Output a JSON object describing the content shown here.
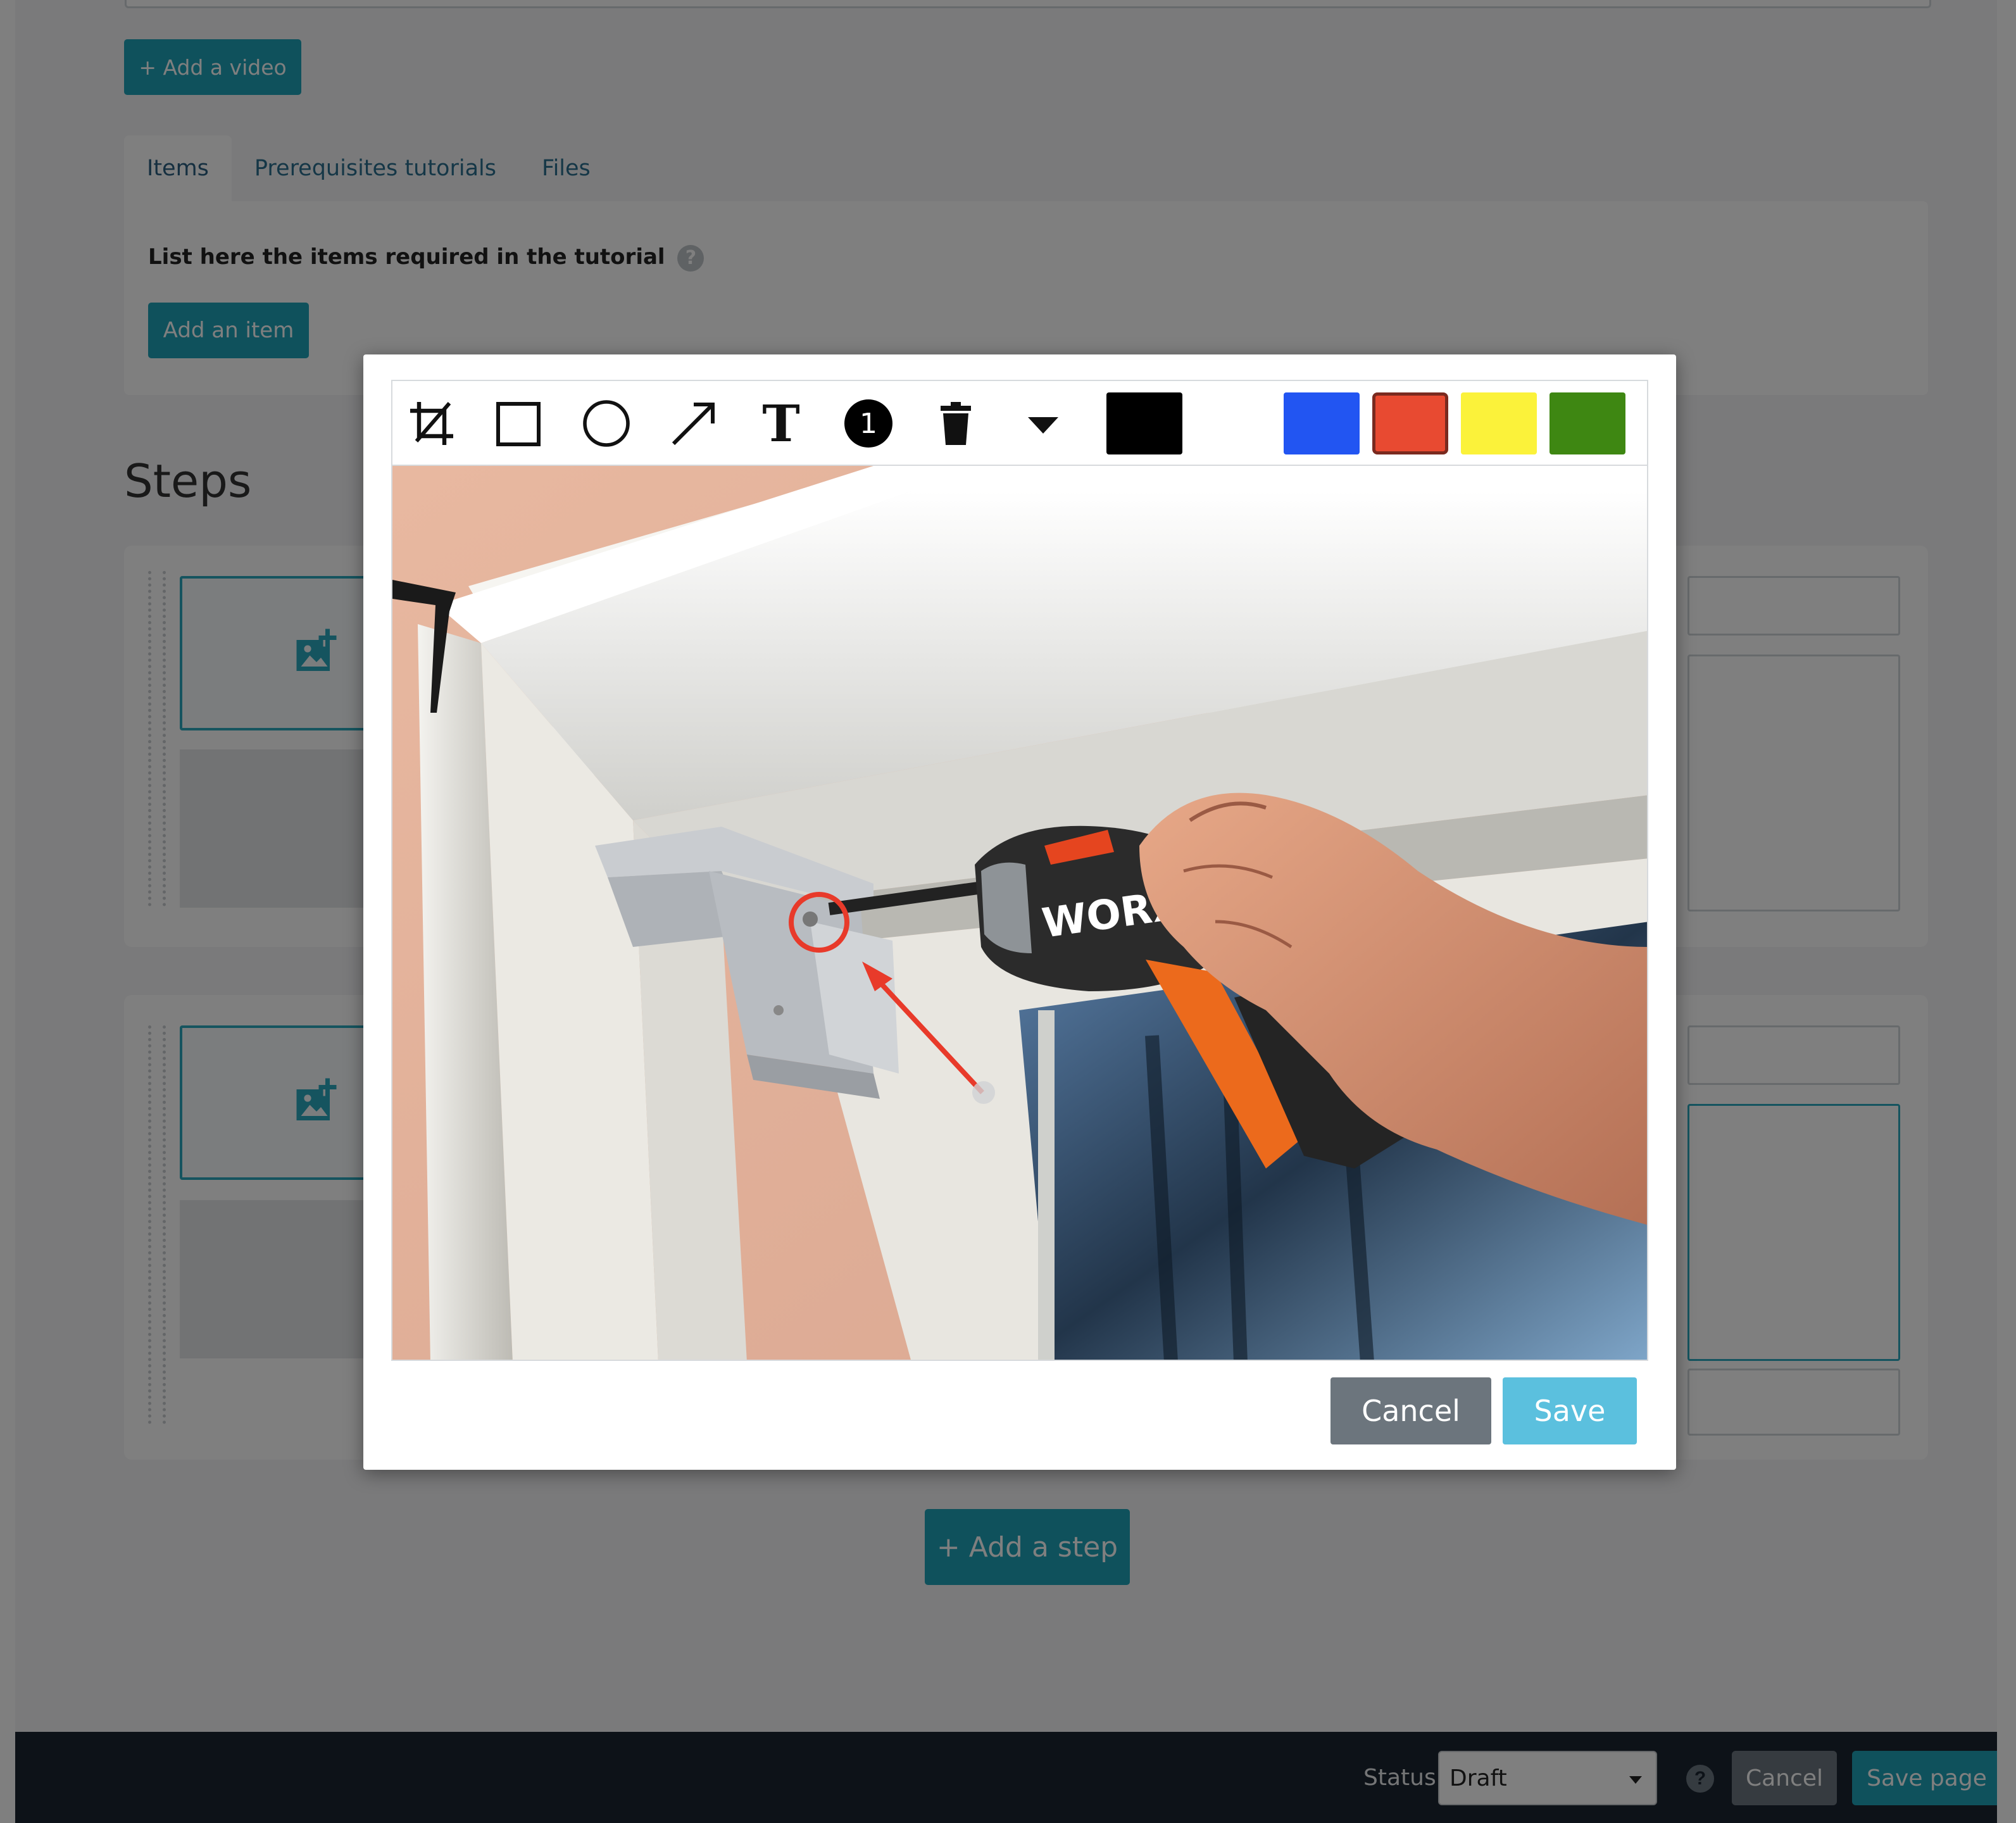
{
  "page": {
    "add_video_label": "+ Add a video",
    "tabs": [
      {
        "label": "Items",
        "active": true
      },
      {
        "label": "Prerequisites tutorials",
        "active": false
      },
      {
        "label": "Files",
        "active": false
      }
    ],
    "items_panel": {
      "label": "List here the items required in the tutorial",
      "help_icon": "question-icon",
      "help_glyph": "?",
      "add_item_label": "Add an item"
    },
    "steps_title": "Steps",
    "wiki_link_glyph": "[[]]",
    "add_step_label": "+ Add a step"
  },
  "footer": {
    "status_label": "Status",
    "status_value": "Draft",
    "help_glyph": "?",
    "cancel_label": "Cancel",
    "save_label": "Save page"
  },
  "editor": {
    "tools": [
      {
        "icon": "crop-icon"
      },
      {
        "icon": "rectangle-icon"
      },
      {
        "icon": "circle-icon"
      },
      {
        "icon": "arrow-icon"
      },
      {
        "icon": "text-icon",
        "glyph": "T"
      },
      {
        "icon": "numbered-marker-icon",
        "glyph": "1"
      },
      {
        "icon": "trash-icon"
      },
      {
        "icon": "dropdown-caret-icon"
      }
    ],
    "colors": [
      {
        "name": "black",
        "hex": "#000000",
        "selected": false
      },
      {
        "name": "white",
        "hex": "#ffffff",
        "selected": false
      },
      {
        "name": "blue",
        "hex": "#2255f2",
        "selected": false
      },
      {
        "name": "red",
        "hex": "#e84a31",
        "selected": true
      },
      {
        "name": "yellow",
        "hex": "#fbf23a",
        "selected": false
      },
      {
        "name": "green",
        "hex": "#3e8712",
        "selected": false
      }
    ],
    "photo": {
      "brand_text": "WORX",
      "annotation_color": "#e83a2a"
    },
    "cancel_label": "Cancel",
    "save_label": "Save"
  },
  "colors": {
    "accent": "#1fa3b8",
    "save_button": "#5bc0de",
    "cancel_button": "#6c757d",
    "footer_bg": "#1a2530"
  }
}
